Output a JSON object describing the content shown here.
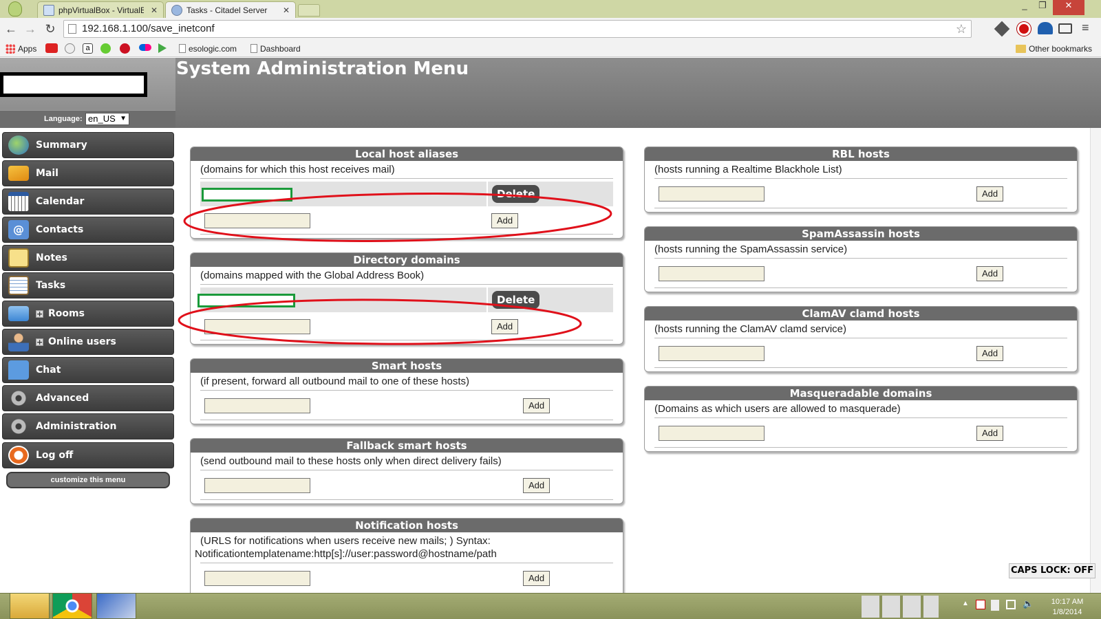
{
  "browser": {
    "tabs": [
      {
        "label": "phpVirtualBox - VirtualBox"
      },
      {
        "label": "Tasks - Citadel Server"
      }
    ],
    "url": "192.168.1.100/save_inetconf",
    "bookmarks": [
      "Apps",
      "esologic.com",
      "Dashboard"
    ],
    "other_bookmarks": "Other bookmarks"
  },
  "header": {
    "title": "System Administration Menu",
    "language_label": "Language:",
    "language_value": "en_US"
  },
  "sidebar": {
    "items": [
      {
        "label": "Summary",
        "icon": "globe-icon"
      },
      {
        "label": "Mail",
        "icon": "envelope-icon"
      },
      {
        "label": "Calendar",
        "icon": "calendar-icon"
      },
      {
        "label": "Contacts",
        "icon": "at-sign-icon"
      },
      {
        "label": "Notes",
        "icon": "notepad-icon"
      },
      {
        "label": "Tasks",
        "icon": "clipboard-icon"
      },
      {
        "label": "Rooms",
        "icon": "folder-icon"
      },
      {
        "label": "Online users",
        "icon": "user-icon"
      },
      {
        "label": "Chat",
        "icon": "chat-icon"
      },
      {
        "label": "Advanced",
        "icon": "gear-icon"
      },
      {
        "label": "Administration",
        "icon": "gear-icon"
      },
      {
        "label": "Log off",
        "icon": "power-icon"
      }
    ],
    "customize": "customize this menu"
  },
  "panels": {
    "local_host_aliases": {
      "title": "Local host aliases",
      "desc": "(domains for which this host receives mail)",
      "delete_label": "Delete",
      "add_label": "Add"
    },
    "directory_domains": {
      "title": "Directory domains",
      "desc": "(domains mapped with the Global Address Book)",
      "delete_label": "Delete",
      "add_label": "Add"
    },
    "smart_hosts": {
      "title": "Smart hosts",
      "desc": "(if present, forward all outbound mail to one of these hosts)",
      "add_label": "Add"
    },
    "fallback_smart_hosts": {
      "title": "Fallback smart hosts",
      "desc": "(send outbound mail to these hosts only when direct delivery fails)",
      "add_label": "Add"
    },
    "notification_hosts": {
      "title": "Notification hosts",
      "desc1": "(URLS for notifications when users receive new mails; ) Syntax:",
      "desc2": "Notificationtemplatename:http[s]://user:password@hostname/path",
      "add_label": "Add"
    },
    "rbl_hosts": {
      "title": "RBL hosts",
      "desc": "(hosts running a Realtime Blackhole List)",
      "add_label": "Add"
    },
    "spamassassin_hosts": {
      "title": "SpamAssassin hosts",
      "desc": "(hosts running the SpamAssassin service)",
      "add_label": "Add"
    },
    "clamav_hosts": {
      "title": "ClamAV clamd hosts",
      "desc": "(hosts running the ClamAV clamd service)",
      "add_label": "Add"
    },
    "masqueradable_domains": {
      "title": "Masqueradable domains",
      "desc": "(Domains as which users are allowed to masquerade)",
      "add_label": "Add"
    }
  },
  "status": {
    "capslock": "CAPS LOCK: OFF"
  },
  "taskbar": {
    "time": "10:17 AM",
    "date": "1/8/2014"
  },
  "colors": {
    "annotation_red": "#e0101a",
    "annotation_green": "#1a9a3a",
    "panel_header": "#6b6b6b"
  }
}
